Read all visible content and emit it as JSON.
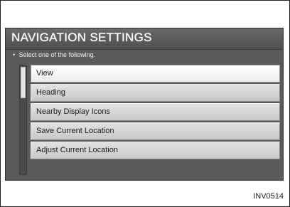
{
  "screen": {
    "title": "NAVIGATION SETTINGS",
    "instruction_bullet": "•",
    "instruction": "Select one of the following."
  },
  "menu": {
    "items": [
      {
        "label": "View",
        "selected": true
      },
      {
        "label": "Heading",
        "selected": false
      },
      {
        "label": "Nearby Display Icons",
        "selected": false
      },
      {
        "label": "Save Current Location",
        "selected": false
      },
      {
        "label": "Adjust Current Location",
        "selected": false
      }
    ]
  },
  "reference_code": "INV0514"
}
